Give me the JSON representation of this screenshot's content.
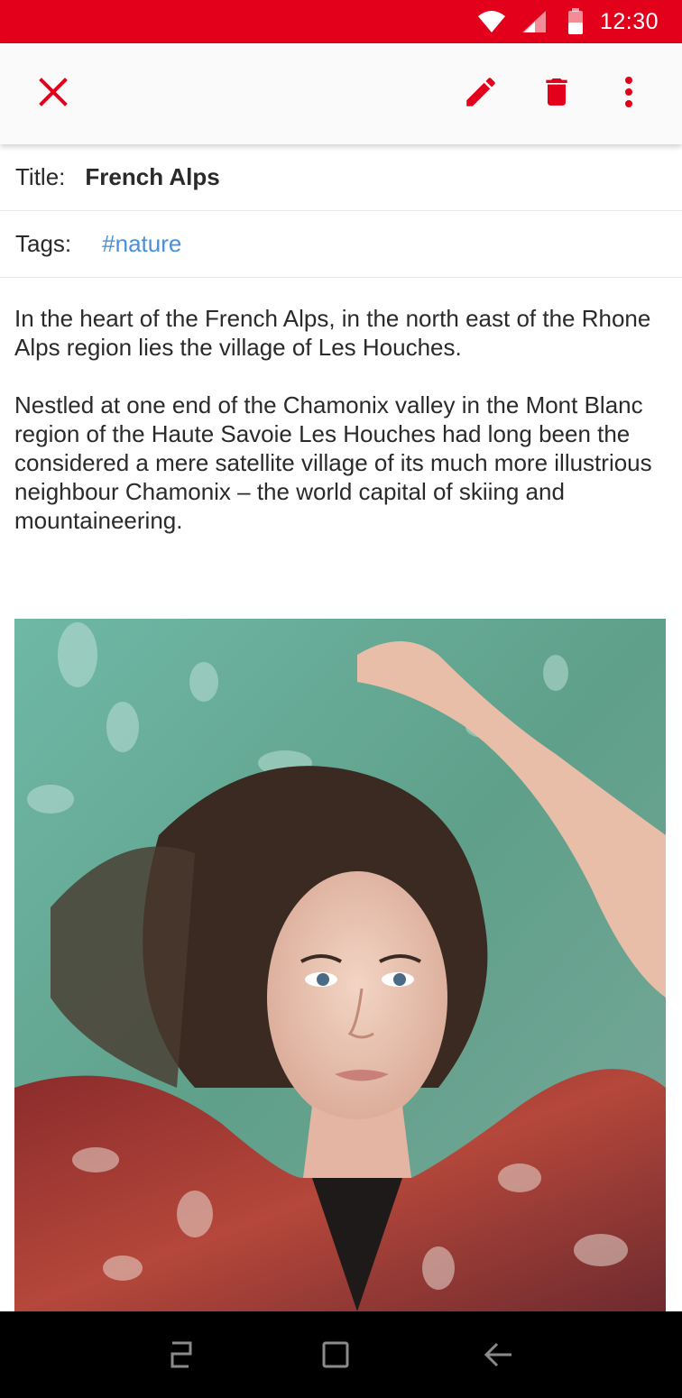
{
  "status_bar": {
    "time": "12:30",
    "wifi_icon": "wifi-icon",
    "signal_icon": "signal-icon",
    "battery_icon": "battery-icon",
    "background_color": "#e2001a"
  },
  "toolbar": {
    "close_icon": "close-icon",
    "edit_icon": "pencil-icon",
    "delete_icon": "trash-icon",
    "more_icon": "more-vert-icon",
    "accent_color": "#e2001a"
  },
  "note": {
    "title_label": "Title:",
    "title": "French Alps",
    "tags_label": "Tags:",
    "tag": "#nature",
    "paragraphs": [
      "In the heart of the French Alps, in the north east of the Rhone Alps region lies the village of Les Houches.",
      "Nestled at one end of the Chamonix valley in the Mont Blanc region of the Haute Savoie Les Houches had long been the considered a mere satellite village of its much more illustrious neighbour Chamonix – the world capital of skiing and mountaineering."
    ]
  },
  "nav_bar": {
    "recents_icon": "recents-icon",
    "home_icon": "home-icon",
    "back_icon": "back-icon"
  }
}
